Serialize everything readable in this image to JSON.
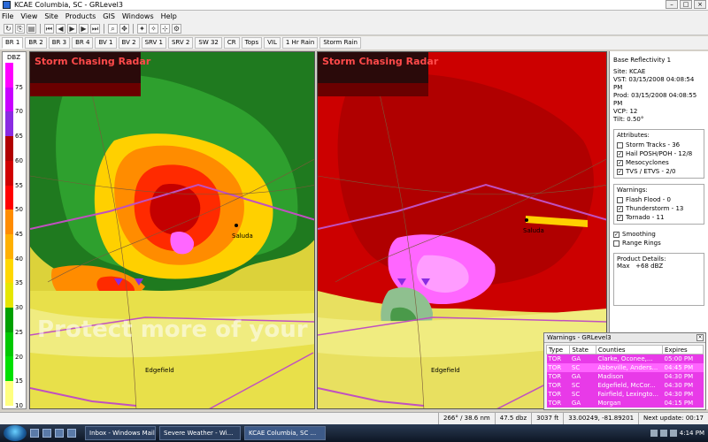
{
  "window": {
    "title": "KCAE Columbia, SC - GRLevel3"
  },
  "menu": [
    "File",
    "View",
    "Site",
    "Products",
    "GIS",
    "Windows",
    "Help"
  ],
  "product_tabs": [
    "BR 1",
    "BR 2",
    "BR 3",
    "BR 4",
    "BV 1",
    "BV 2",
    "SRV 1",
    "SRV 2",
    "SW 32",
    "CR",
    "Tops",
    "VIL",
    "1 Hr Rain",
    "Storm Rain"
  ],
  "scale": {
    "unit": "DBZ",
    "labels": [
      "75",
      "70",
      "65",
      "60",
      "55",
      "50",
      "45",
      "40",
      "35",
      "30",
      "25",
      "20",
      "15",
      "10"
    ]
  },
  "panels": {
    "banner": "Storm Chasing Radar",
    "towns": [
      "Saluda",
      "Edgefield"
    ],
    "watermark": "Protect more of your memories for less!"
  },
  "info": {
    "product": "Base Reflectivity 1",
    "site": "Site:  KCAE",
    "vst": "VST: 03/15/2008  04:08:54 PM",
    "prod": "Prod: 03/15/2008  04:08:55 PM",
    "vcp": "VCP: 12",
    "tilt": "Tilt:   0.50°",
    "attributes_title": "Attributes:",
    "attributes": [
      {
        "label": "Storm Tracks - 36",
        "checked": false
      },
      {
        "label": "Hail POSH/POH - 12/8",
        "checked": true
      },
      {
        "label": "Mesocyclones",
        "checked": true
      },
      {
        "label": "TVS / ETVS - 2/0",
        "checked": true
      }
    ],
    "warnings_title": "Warnings:",
    "warnings": [
      {
        "label": "Flash Flood - 0",
        "checked": false
      },
      {
        "label": "Thunderstorm - 13",
        "checked": true
      },
      {
        "label": "Tornado - 11",
        "checked": true
      }
    ],
    "options": [
      {
        "label": "Smoothing",
        "checked": true
      },
      {
        "label": "Range Rings",
        "checked": false
      }
    ],
    "details_title": "Product Details:",
    "max_label": "Max",
    "max_value": "+68 dBZ"
  },
  "warn_window": {
    "title": "Warnings - GRLevel3",
    "columns": [
      "Type",
      "State",
      "Counties",
      "Expires"
    ],
    "rows": [
      [
        "TOR",
        "GA",
        "Clarke, Oconee,...",
        "05:00 PM"
      ],
      [
        "TOR",
        "SC",
        "Abbeville, Anders...",
        "04:45 PM"
      ],
      [
        "TOR",
        "GA",
        "Madison",
        "04:30 PM"
      ],
      [
        "TOR",
        "SC",
        "Edgefield, McCor...",
        "04:30 PM"
      ],
      [
        "TOR",
        "SC",
        "Fairfield, Lexingto...",
        "04:30 PM"
      ],
      [
        "TOR",
        "GA",
        "Morgan",
        "04:15 PM"
      ]
    ]
  },
  "status": [
    "266° / 38.6 nm",
    "47.5 dbz",
    "3037 ft",
    "33.00249, -81.89201",
    "Next update: 00:17"
  ],
  "taskbar": {
    "tasks": [
      "Inbox - Windows Mail",
      "Severe Weather - Wi...",
      "KCAE Columbia, SC ..."
    ],
    "clock": "4:14 PM"
  },
  "colors": {
    "scale": [
      "#ff00ff",
      "#c800ff",
      "#8a2be2",
      "#b00000",
      "#d00000",
      "#ff0000",
      "#ff8c00",
      "#ffb000",
      "#ffd700",
      "#e6e600",
      "#00a000",
      "#00c800",
      "#00e000",
      "#ffff80"
    ],
    "warning_row": "#e83ae8"
  }
}
